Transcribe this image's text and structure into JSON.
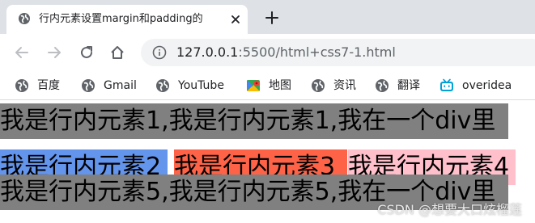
{
  "tab": {
    "title": "行内元素设置margin和padding的"
  },
  "address": {
    "host": "127.0.0.1",
    "rest": ":5500/html+css7-1.html"
  },
  "bookmarks": [
    {
      "label": "百度",
      "icon": "globe-icon"
    },
    {
      "label": "Gmail",
      "icon": "globe-icon"
    },
    {
      "label": "YouTube",
      "icon": "globe-icon"
    },
    {
      "label": "地图",
      "icon": "maps-icon"
    },
    {
      "label": "资讯",
      "icon": "globe-icon"
    },
    {
      "label": "翻译",
      "icon": "globe-icon"
    },
    {
      "label": "overidea",
      "icon": "bilibili-tv-icon"
    }
  ],
  "page": {
    "line1": "我是行内元素1,我是行内元素1,我在一个div里",
    "seg2": "我是行内元素2",
    "seg3": "我是行内元素3",
    "seg4": "我是行内元素4",
    "line3": "我是行内元素5,我是行内元素5,我在一个div里"
  },
  "colors": {
    "gray": "#808080",
    "blue": "#6495ed",
    "tomato": "#ff6347",
    "pink": "#ffc0cb"
  },
  "watermark": "CSDN @想要大口炫榴莲"
}
